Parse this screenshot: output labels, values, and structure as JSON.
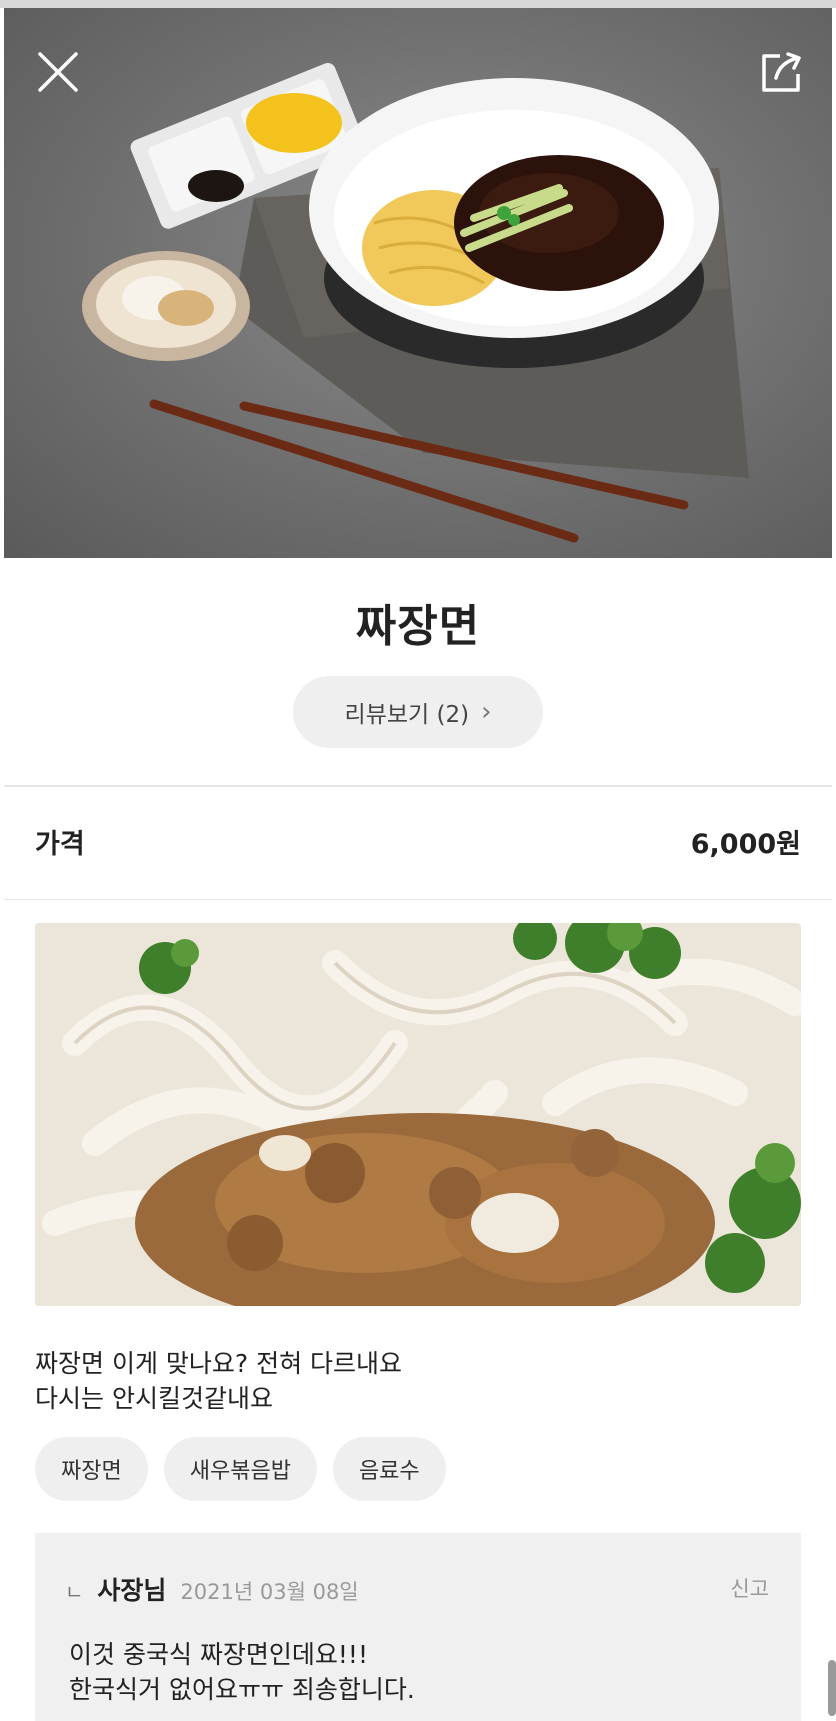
{
  "menu": {
    "name": "짜장면",
    "review_button": "리뷰보기 (2)",
    "price_label": "가격",
    "price_value": "6,000원"
  },
  "review": {
    "text_line1": "짜장면 이게 맞나요? 전혀 다르내요",
    "text_line2": "다시는 안시킬것같내요",
    "tags": [
      "짜장면",
      "새우볶음밥",
      "음료수"
    ]
  },
  "reply": {
    "arrow": "ㄴ",
    "author": "사장님",
    "date": "2021년 03월 08일",
    "report": "신고",
    "line1": "이것 중국식 짜장면인데요!!!",
    "line2": "한국식거 없어요ㅠㅠ 죄송합니다."
  },
  "icons": {
    "close": "close-icon",
    "share": "share-icon",
    "chevron": "chevron-right-icon"
  }
}
